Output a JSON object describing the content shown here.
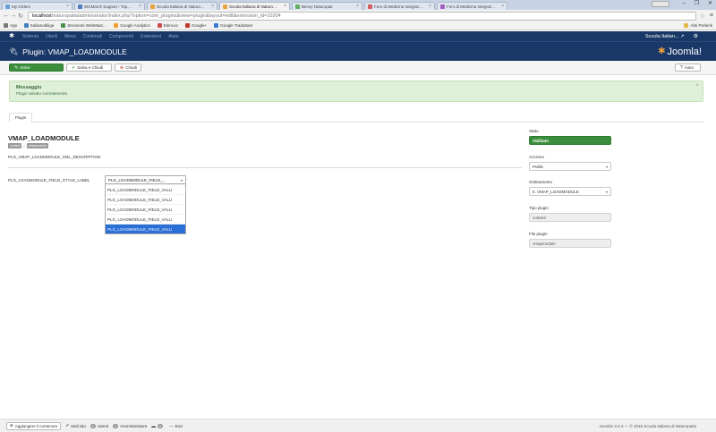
{
  "browser": {
    "tabs": [
      {
        "label": "My Orders",
        "color": "#6aa0d8",
        "active": false
      },
      {
        "label": "WCMarch Support › Top…",
        "color": "#4e7dc0",
        "active": false
      },
      {
        "label": "Scuola Italiana di Naturo…",
        "color": "#e8a33b",
        "active": false
      },
      {
        "label": "Scuola Italiana di Naturo…",
        "color": "#e8a33b",
        "active": true
      },
      {
        "label": "Benvy Naturopati",
        "color": "#5fae5f",
        "active": false
      },
      {
        "label": "Foro di Medicina Integrat…",
        "color": "#d45d5d",
        "active": false
      },
      {
        "label": "Foro di Medicina Integrat…",
        "color": "#a35dc0",
        "active": false
      }
    ],
    "url_host": "localhost",
    "url_path": "/naturopatia/administrator/index.php?option=com_plugins&view=plugin&layout=edit&extension_id=10204",
    "bookmarks": [
      {
        "label": "App",
        "color": "#777"
      },
      {
        "label": "Italiamobiliga",
        "color": "#3f7fbf"
      },
      {
        "label": "Strumenti WebMast…",
        "color": "#4b8f4b"
      },
      {
        "label": "Google Analytics",
        "color": "#f0a030"
      },
      {
        "label": "Elencoo",
        "color": "#d04a4a"
      },
      {
        "label": "Google+",
        "color": "#c0392b"
      },
      {
        "label": "Google Traduttore",
        "color": "#3a7bd5"
      }
    ],
    "bookmarks_right": "Altri Preferiti"
  },
  "joomla": {
    "nav": [
      "Sistema",
      "Utenti",
      "Menu",
      "Contenuti",
      "Componenti",
      "Estensioni",
      "Aiuto"
    ],
    "site_name": "Scuola Italian... ↗",
    "page_title": "Plugin: VMAP_LOADMODULE",
    "brand": "Joomla!"
  },
  "toolbar": {
    "save": "Salva",
    "save_close": "Salva e Chiudi",
    "close": "Chiudi",
    "help": "Aiuto"
  },
  "message": {
    "heading": "Messaggio",
    "text": "Plugin salvato correttamente."
  },
  "tabs": {
    "plugin": "Plugin"
  },
  "plugin": {
    "name": "VMAP_LOADMODULE",
    "badge_type": "content",
    "badge_element": "vmapmodule",
    "description": "PLG_VMAP_LOADMODULE_XML_DESCRIPTION",
    "field_label": "PLG_LOADMODULE_FIELD_STYLE_LABEL",
    "select_value": "PLG_LOADMODULE_FIELD_...",
    "options": [
      "PLG_LOADMODULE_FIELD_VALU",
      "PLG_LOADMODULE_FIELD_VALU",
      "PLG_LOADMODULE_FIELD_VALU",
      "PLG_LOADMODULE_FIELD_VALU",
      "PLG_LOADMODULE_FIELD_VALU"
    ]
  },
  "side": {
    "status_label": "Stato",
    "status_value": "Abilitato",
    "access_label": "Accesso",
    "access_value": "Public",
    "order_label": "Ordinamento",
    "order_value": "0. VMAP_LOADMODULE",
    "type_label": "Tipo plugin",
    "type_value": "content",
    "file_label": "File plugin",
    "file_value": "vmapmodule"
  },
  "footer": {
    "add_content": "Aggiungere il contenuto",
    "view_site": "Vedi sito",
    "visitors_count": "0",
    "visitors_label": "Utenti",
    "admins_count": "1",
    "admins_label": "Amministratore",
    "messages_count": "0",
    "logout": "Esci",
    "version": "Joomla! 3.4.4 — © 2015 Scuola Italiana di Naturopatia"
  }
}
